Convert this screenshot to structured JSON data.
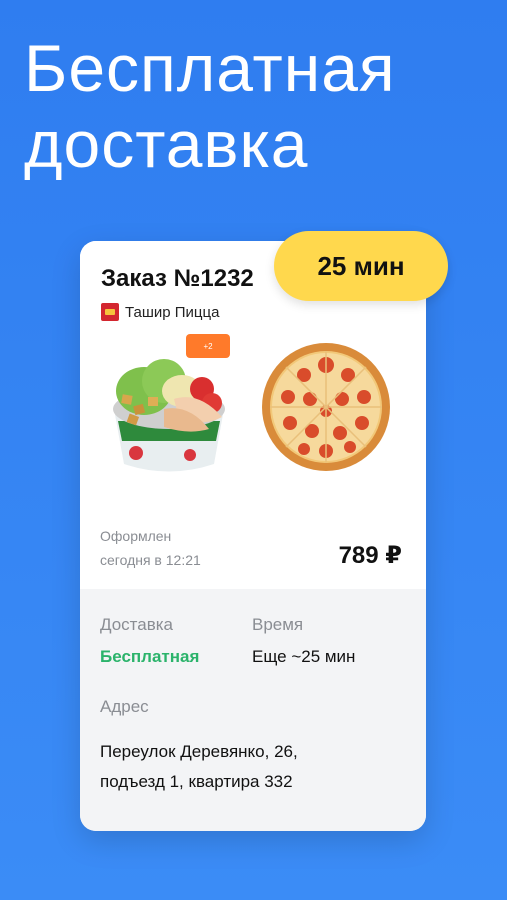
{
  "headline": {
    "line1": "Бесплатная",
    "line2": "доставка"
  },
  "eta_badge": "25 мин",
  "order": {
    "title": "Заказ №1232",
    "restaurant": "Ташир Пицца",
    "item_badge": "+2",
    "status_line1": "Оформлен",
    "status_line2": "сегодня в 12:21",
    "price": "789 ₽"
  },
  "details": {
    "delivery_label": "Доставка",
    "delivery_value": "Бесплатная",
    "time_label": "Время",
    "time_value": "Еще ~25 мин",
    "address_label": "Адрес",
    "address_line1": "Переулок Деревянко, 26,",
    "address_line2": "подъезд 1, квартира 332"
  },
  "colors": {
    "background": "#3385f2",
    "eta_badge": "#ffd84d",
    "free_delivery": "#2bb36b"
  },
  "icons": [
    "restaurant-logo-icon",
    "salad-image",
    "pizza-image"
  ]
}
